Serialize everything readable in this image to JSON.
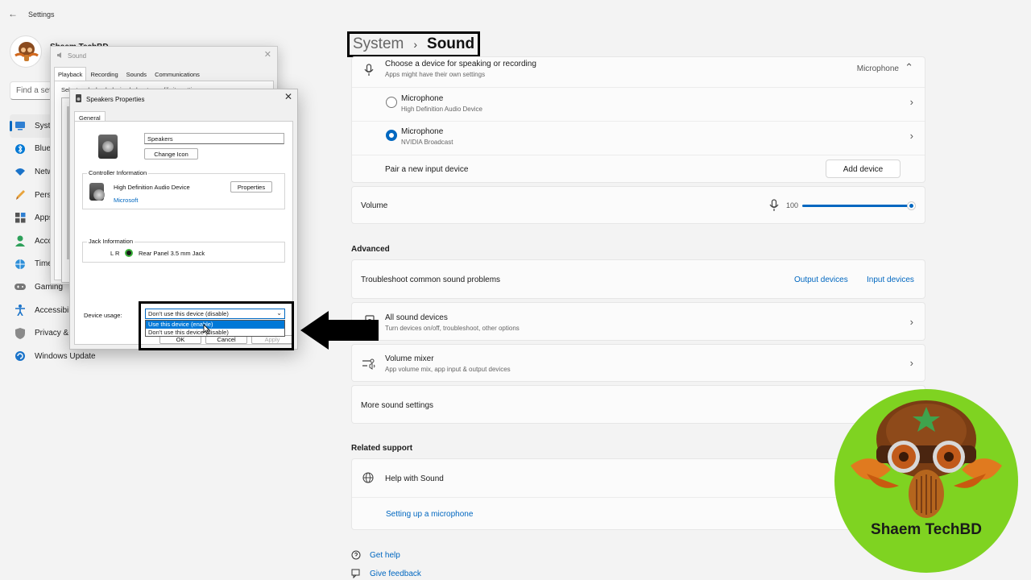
{
  "window": {
    "app_title": "Settings",
    "profile_name": "Shaem TechBD",
    "find_placeholder": "Find a setting"
  },
  "nav": [
    {
      "label": "System",
      "icon": "system-icon",
      "active": true
    },
    {
      "label": "Bluetooth & devices",
      "icon": "bluetooth-icon"
    },
    {
      "label": "Network & internet",
      "icon": "wifi-icon"
    },
    {
      "label": "Personalization",
      "icon": "brush-icon"
    },
    {
      "label": "Apps",
      "icon": "apps-icon"
    },
    {
      "label": "Accounts",
      "icon": "account-icon"
    },
    {
      "label": "Time & language",
      "icon": "globe-icon"
    },
    {
      "label": "Gaming",
      "icon": "gamepad-icon"
    },
    {
      "label": "Accessibility",
      "icon": "accessibility-icon"
    },
    {
      "label": "Privacy & security",
      "icon": "shield-icon"
    },
    {
      "label": "Windows Update",
      "icon": "update-icon"
    }
  ],
  "breadcrumb": {
    "parent": "System",
    "separator": "›",
    "current": "Sound"
  },
  "input": {
    "choose_title": "Choose a device for speaking or recording",
    "choose_sub": "Apps might have their own settings",
    "selected_device": "Microphone",
    "devices": [
      {
        "name": "Microphone",
        "sub": "High Definition Audio Device",
        "checked": false
      },
      {
        "name": "Microphone",
        "sub": "NVIDIA Broadcast",
        "checked": true
      }
    ],
    "pair_label": "Pair a new input device",
    "add_device_label": "Add device",
    "volume_label": "Volume",
    "volume_value": "100",
    "volume_fraction": 1.0
  },
  "advanced": {
    "heading": "Advanced",
    "troubleshoot_label": "Troubleshoot common sound problems",
    "output_devices_link": "Output devices",
    "input_devices_link": "Input devices",
    "all_devices_title": "All sound devices",
    "all_devices_sub": "Turn devices on/off, troubleshoot, other options",
    "mixer_title": "Volume mixer",
    "mixer_sub": "App volume mix, app input & output devices",
    "more_settings": "More sound settings"
  },
  "related": {
    "heading": "Related support",
    "help_title": "Help with Sound",
    "mic_link": "Setting up a microphone"
  },
  "footer": {
    "get_help": "Get help",
    "give_feedback": "Give feedback"
  },
  "sound_dialog": {
    "title": "Sound",
    "tabs": [
      "Playback",
      "Recording",
      "Sounds",
      "Communications"
    ],
    "hint": "Select a playback device below to modify its settings:"
  },
  "speakers_dialog": {
    "title": "Speakers Properties",
    "tab": "General",
    "name_value": "Speakers",
    "change_icon": "Change Icon",
    "controller_heading": "Controller Information",
    "controller_name": "High Definition Audio Device",
    "controller_vendor": "Microsoft",
    "properties_btn": "Properties",
    "jack_heading": "Jack Information",
    "jack_channels": "L R",
    "jack_name": "Rear Panel 3.5 mm Jack",
    "usage_label": "Device usage:",
    "usage_selected": "Don't use this device (disable)",
    "usage_options": [
      "Use this device (enable)",
      "Don't use this device (disable)"
    ],
    "ok": "OK",
    "cancel": "Cancel",
    "apply": "Apply"
  },
  "logo": {
    "text": "Shaem TechBD"
  },
  "colors": {
    "accent": "#0067c0",
    "logo_bg": "#7fd321"
  }
}
